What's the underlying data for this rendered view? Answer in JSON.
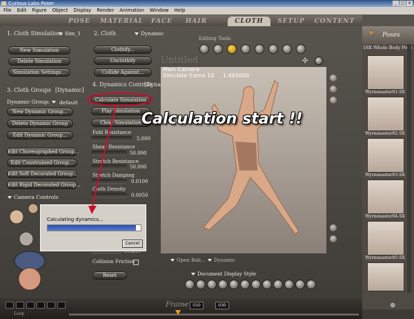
{
  "window": {
    "title": "Curious Labs Poser",
    "buttons": [
      "_",
      "□",
      "×"
    ]
  },
  "menu": [
    "File",
    "Edit",
    "Figure",
    "Object",
    "Display",
    "Render",
    "Animation",
    "Window",
    "Help"
  ],
  "tabs": [
    {
      "label": "POSE",
      "active": false
    },
    {
      "label": "MATERIAL",
      "active": false
    },
    {
      "label": "FACE",
      "active": false
    },
    {
      "label": "HAIR",
      "active": false
    },
    {
      "label": "CLOTH",
      "active": true
    },
    {
      "label": "SETUP",
      "active": false
    },
    {
      "label": "CONTENT",
      "active": false
    }
  ],
  "cloth_simulation": {
    "heading": "1. Cloth Simulation:",
    "selected": "Sim_1",
    "buttons": [
      "New Simulation",
      "Delete Simulation",
      "Simulation Settings..."
    ]
  },
  "cloth_groups": {
    "heading": "3. Cloth Groups",
    "badge": "[Dynamic]",
    "group_label": "Dynamic Group:",
    "group_value": "default",
    "buttons": [
      "New Dynamic Group...",
      "Delete Dynamic Group",
      "Edit Dynamic Group...",
      "Edit Choreographed Group...",
      "Edit Constrained Group...",
      "Edit Soft Decorated Group...",
      "Edit Rigid Decorated Group..."
    ]
  },
  "camera_controls": {
    "label": "Camera Controls"
  },
  "cloth": {
    "heading": "2. Cloth",
    "value": "Dynamic",
    "buttons": [
      "Clothify...",
      "Unclothify",
      "Collide Against..."
    ]
  },
  "dynamics": {
    "heading": "4. Dynamics Controls",
    "badge": "[Dynamic",
    "buttons": [
      "Calculate Simulation",
      "Play Simulation",
      "Clear Simulation"
    ],
    "params": [
      {
        "label": "Fold Resistance",
        "value": "5.000"
      },
      {
        "label": "Shear Resistance",
        "value": "50.000"
      },
      {
        "label": "Stretch Resistance",
        "value": "50.000"
      },
      {
        "label": "Stretch Damping",
        "value": "0.0100"
      },
      {
        "label": "Cloth Density",
        "value": "0.0050"
      }
    ],
    "extra_value": "0.0200",
    "collision_label": "Collision Friction",
    "reset_label": "Reset"
  },
  "viewport": {
    "title": "Untitled",
    "camera": "Main Camera",
    "status": "Simulate frame 10",
    "time": "1.465000",
    "editing_tools_label": "Editing Tools",
    "document_style_label": "Document Display Style",
    "open_label": "Open Bab...",
    "dynamic_label": "Dynamic"
  },
  "dialog": {
    "message": "Calculating dynamics...",
    "cancel": "Cancel",
    "progress": 0.95
  },
  "poses_panel": {
    "title": "Poses",
    "category": "18X Whole Body Pose",
    "items": [
      "Wyrmmaster01-SX",
      "Wyrmmaster02-SX",
      "Wyrmmaster03-SX",
      "Wyrmmaster04-SX",
      "Wyrmmaster05-SX"
    ]
  },
  "timeline": {
    "frame_label": "Frame",
    "frame": "010",
    "total": "030",
    "loop": "Loop"
  },
  "annotation": {
    "text": "Calculation start !!",
    "color": "#c8102e"
  }
}
